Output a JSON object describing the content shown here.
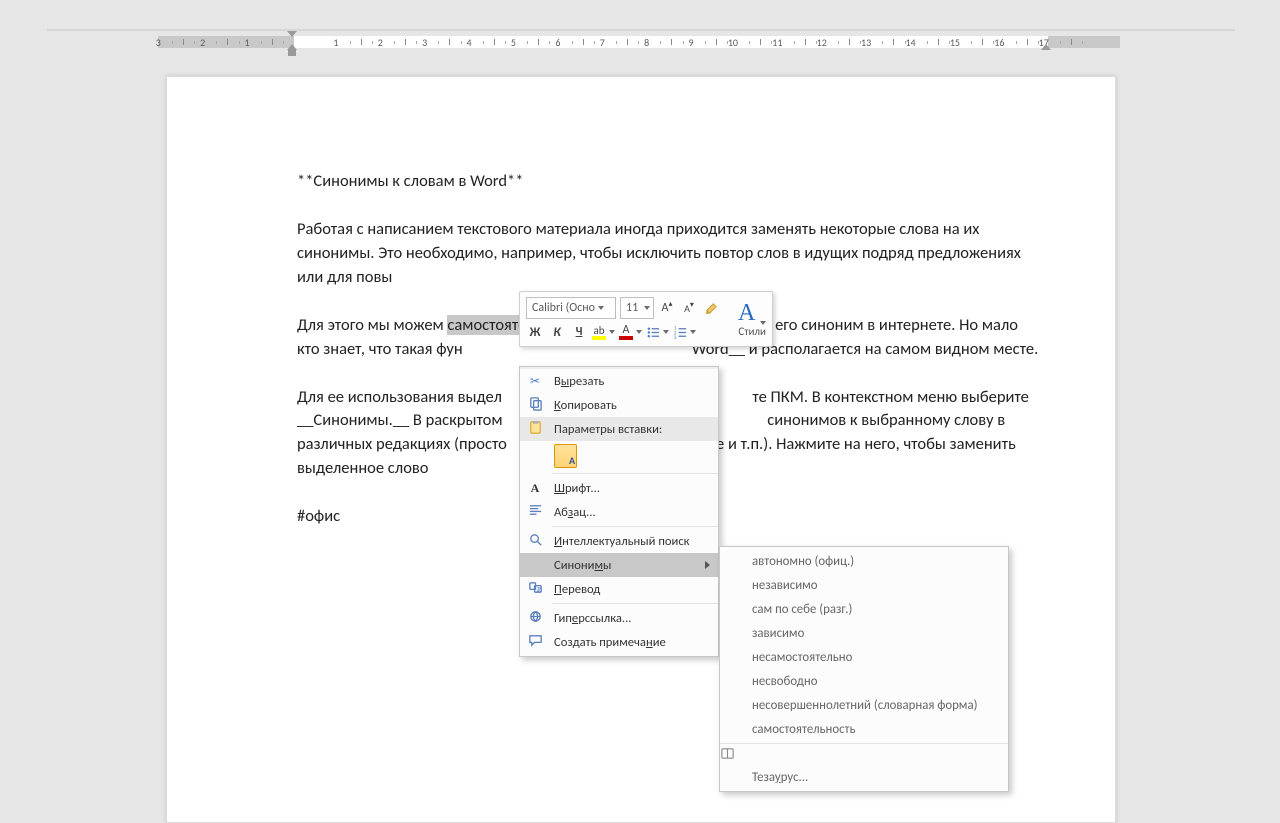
{
  "ruler": {
    "left_grey_range": [
      -3,
      0
    ],
    "right_grey_range": [
      17,
      18
    ],
    "major_numbers": [
      -3,
      -2,
      -1,
      1,
      2,
      3,
      4,
      5,
      6,
      7,
      8,
      9,
      10,
      11,
      12,
      13,
      14,
      15,
      16,
      17
    ]
  },
  "document": {
    "title_line": "**Синонимы к словам в Word**",
    "p1": "Работая с написанием текстового материала иногда приходится заменять некоторые слова на их синонимы. Это необходимо, например, чтобы исключить повтор слов в идущих подряд предложениях или для повы",
    "p2_pre": "Для этого мы можем ",
    "p2_highlight": "самостоятельно",
    "p2_after_a": " изменить слово или поискать его синоним в интернете. Но мало кто знает, что такая фун",
    "p2_after_b": "Word__ и располагается на самом видном месте.",
    "p3_pre": "Для ее использования выдел",
    "p3_mid": "те ПКМ. В контекстном меню выберите __Синонимы.__ В раскрытом",
    "p3_mid2": " синонимов к выбранному слову в различных редакциях (просто",
    "p3_mid3": "ое и т.п.). Нажмите на него, чтобы заменить выделенное слово ",
    "hashtag": "#офис"
  },
  "mini_toolbar": {
    "font_name": "Calibri (Осно",
    "font_size": "11",
    "increase_font_tip": "A↑",
    "decrease_font_tip": "A↓",
    "styles_label": "Стили",
    "bold": "Ж",
    "italic": "К",
    "underline": "Ч",
    "font_color_letter": "A"
  },
  "context_menu": {
    "cut": "Вырезать",
    "copy": "Копировать",
    "paste_options": "Параметры вставки:",
    "paste_keep_text": "A",
    "font": "Шрифт...",
    "paragraph": "Абзац...",
    "smart_lookup": "Интеллектуальный поиск",
    "synonyms": "Синонимы",
    "translate": "Перевод",
    "hyperlink": "Гиперссылка...",
    "new_comment": "Создать примечание",
    "underline_pos": {
      "cut": 1,
      "copy": 0,
      "font": 0,
      "paragraph": 2,
      "smart": 0,
      "synonyms": 6,
      "translate": 0,
      "hyperlink": 3,
      "comment": 15
    }
  },
  "synonyms_submenu": {
    "items": [
      "автономно (офиц.)",
      "независимо",
      "сам по себе (разг.)",
      "зависимо",
      "несамостоятельно",
      "несвободно",
      "несовершеннолетний (словарная форма)",
      "самостоятельность"
    ],
    "thesaurus": "Тезаурус..."
  },
  "colors": {
    "accent_blue": "#2a6abf",
    "highlight_grey": "#c8c8c8"
  }
}
